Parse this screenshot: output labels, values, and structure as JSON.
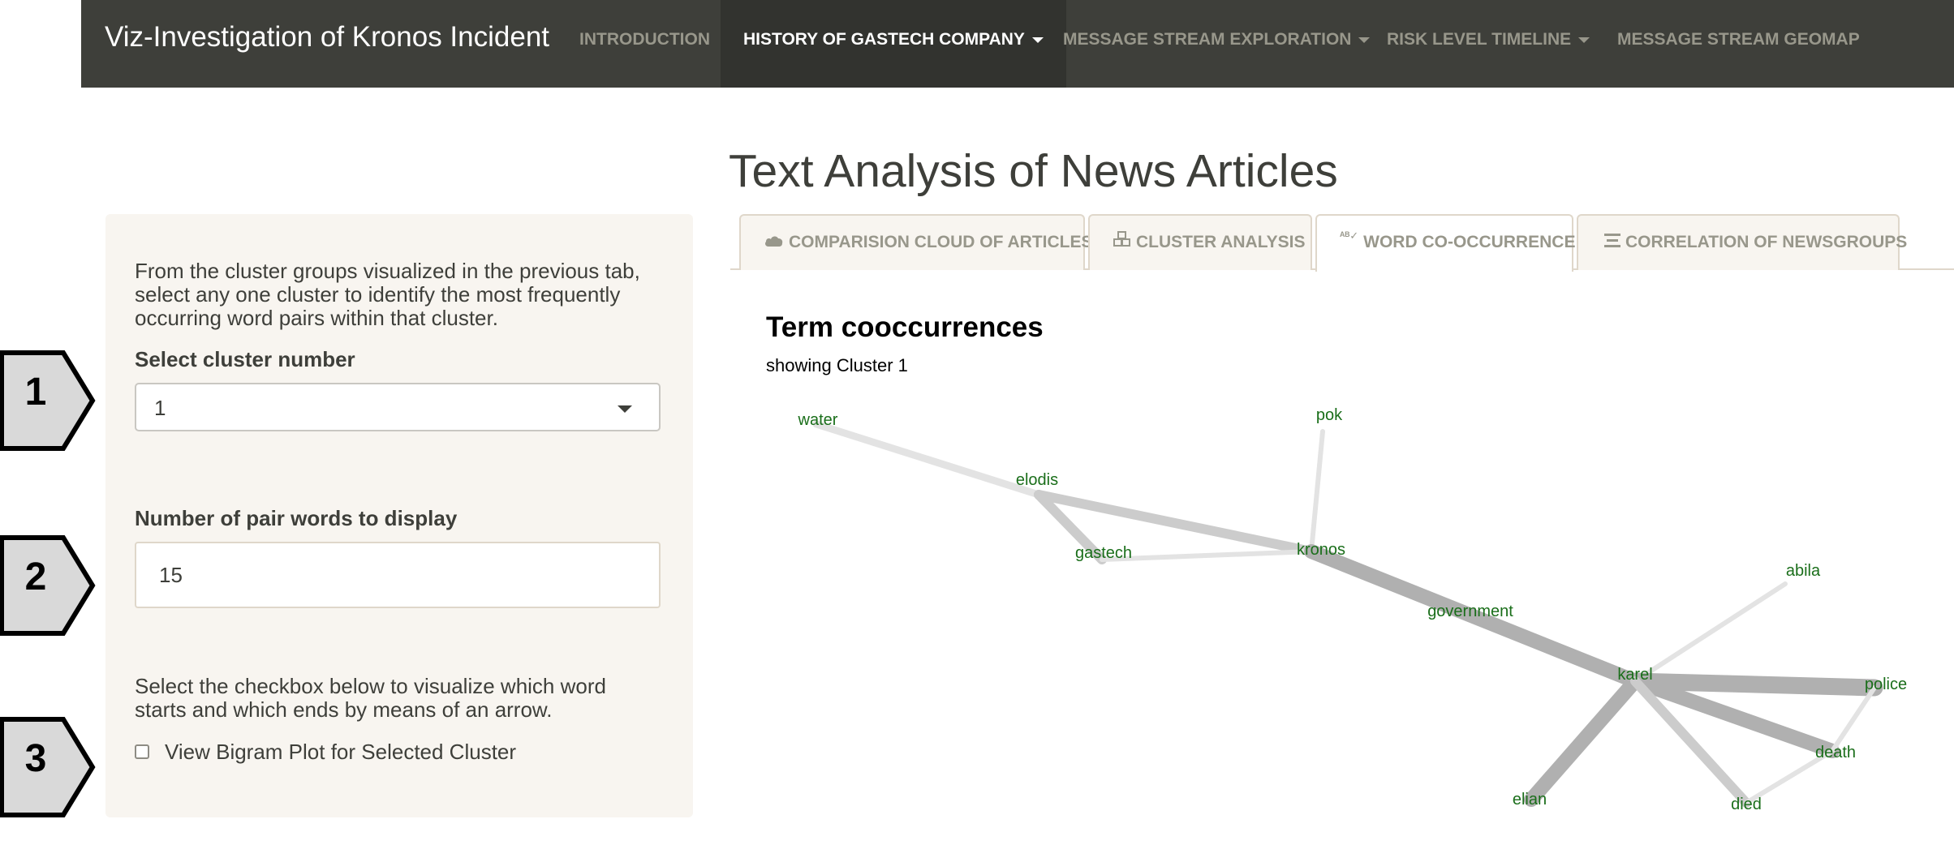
{
  "navbar": {
    "brand": "Viz-Investigation of Kronos Incident",
    "items": [
      {
        "label": "INTRODUCTION",
        "active": false,
        "dropdown": false
      },
      {
        "label": "HISTORY OF GASTECH COMPANY",
        "active": true,
        "dropdown": true
      },
      {
        "label": "MESSAGE STREAM EXPLORATION",
        "active": false,
        "dropdown": true
      },
      {
        "label": "RISK LEVEL TIMELINE",
        "active": false,
        "dropdown": true
      },
      {
        "label": "MESSAGE STREAM GEOMAP",
        "active": false,
        "dropdown": false
      }
    ]
  },
  "page_title": "Text Analysis of News Articles",
  "sidebar": {
    "intro_text": "From the cluster groups visualized in the previous tab, select any one cluster to identify the most frequently occurring word pairs within that cluster.",
    "cluster_label": "Select cluster number",
    "cluster_value": "1",
    "pairs_label": "Number of pair words to display",
    "pairs_value": "15",
    "checkbox_help": "Select the checkbox below to visualize which word starts and which ends by means of an arrow.",
    "checkbox_label": "View Bigram Plot for Selected Cluster",
    "checkbox_checked": false
  },
  "badges": [
    "1",
    "2",
    "3"
  ],
  "tabs": [
    {
      "label": "COMPARISION CLOUD OF ARTICLES",
      "icon": "cloud-icon",
      "active": false
    },
    {
      "label": "CLUSTER ANALYSIS",
      "icon": "cubes-icon",
      "active": false
    },
    {
      "label": "WORD CO-OCCURRENCE",
      "icon": "spell-check-icon",
      "active": true
    },
    {
      "label": "CORRELATION OF NEWSGROUPS",
      "icon": "align-justify-icon",
      "active": false
    }
  ],
  "chart": {
    "title": "Term cooccurrences",
    "subtitle": "showing Cluster 1"
  },
  "chart_data": {
    "type": "network",
    "title": "Term cooccurrences",
    "subtitle": "showing Cluster 1",
    "node_color": "#1a6e1a",
    "edge_color": "#b5b5b5",
    "nodes": [
      "water",
      "pok",
      "elodis",
      "gastech",
      "kronos",
      "government",
      "abila",
      "karel",
      "police",
      "death",
      "elian",
      "died"
    ],
    "edges": [
      {
        "source": "water",
        "target": "elodis",
        "weight": 2
      },
      {
        "source": "elodis",
        "target": "kronos",
        "weight": 3
      },
      {
        "source": "elodis",
        "target": "gastech",
        "weight": 3
      },
      {
        "source": "gastech",
        "target": "kronos",
        "weight": 1
      },
      {
        "source": "pok",
        "target": "kronos",
        "weight": 1
      },
      {
        "source": "kronos",
        "target": "karel",
        "weight": 5
      },
      {
        "source": "karel",
        "target": "abila",
        "weight": 1
      },
      {
        "source": "karel",
        "target": "police",
        "weight": 6
      },
      {
        "source": "karel",
        "target": "death",
        "weight": 5
      },
      {
        "source": "karel",
        "target": "elian",
        "weight": 5
      },
      {
        "source": "karel",
        "target": "died",
        "weight": 3
      },
      {
        "source": "police",
        "target": "death",
        "weight": 1
      },
      {
        "source": "death",
        "target": "died",
        "weight": 1
      }
    ]
  }
}
